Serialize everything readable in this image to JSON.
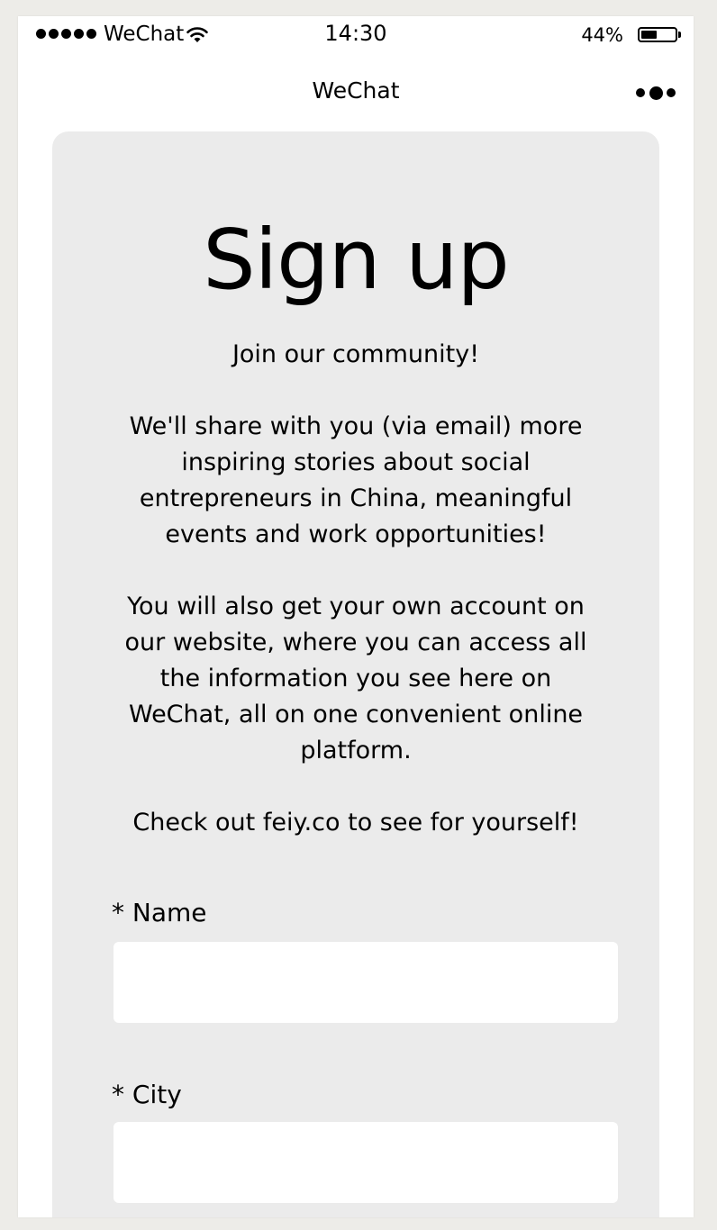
{
  "status_bar": {
    "carrier": "WeChat",
    "time": "14:30",
    "battery_percent": "44%",
    "battery_level": 0.44,
    "signal_dots": 5
  },
  "nav": {
    "title": "WeChat",
    "more_icon": "more-dots-icon"
  },
  "page": {
    "title": "Sign up",
    "paragraphs": [
      "Join our community!",
      "We'll share with you (via email) more inspiring stories about social entrepreneurs in China, meaningful events and work opportunities!",
      "You will also get your own account on our website, where you can access all the information you see here on WeChat, all on one convenient online platform.",
      "Check out feiy.co to see for yourself!"
    ]
  },
  "form": {
    "name_label": "* Name",
    "name_value": "",
    "city_label": "* City",
    "city_value": ""
  },
  "colors": {
    "background": "#edece8",
    "card": "#ebebeb",
    "input": "#ffffff"
  }
}
